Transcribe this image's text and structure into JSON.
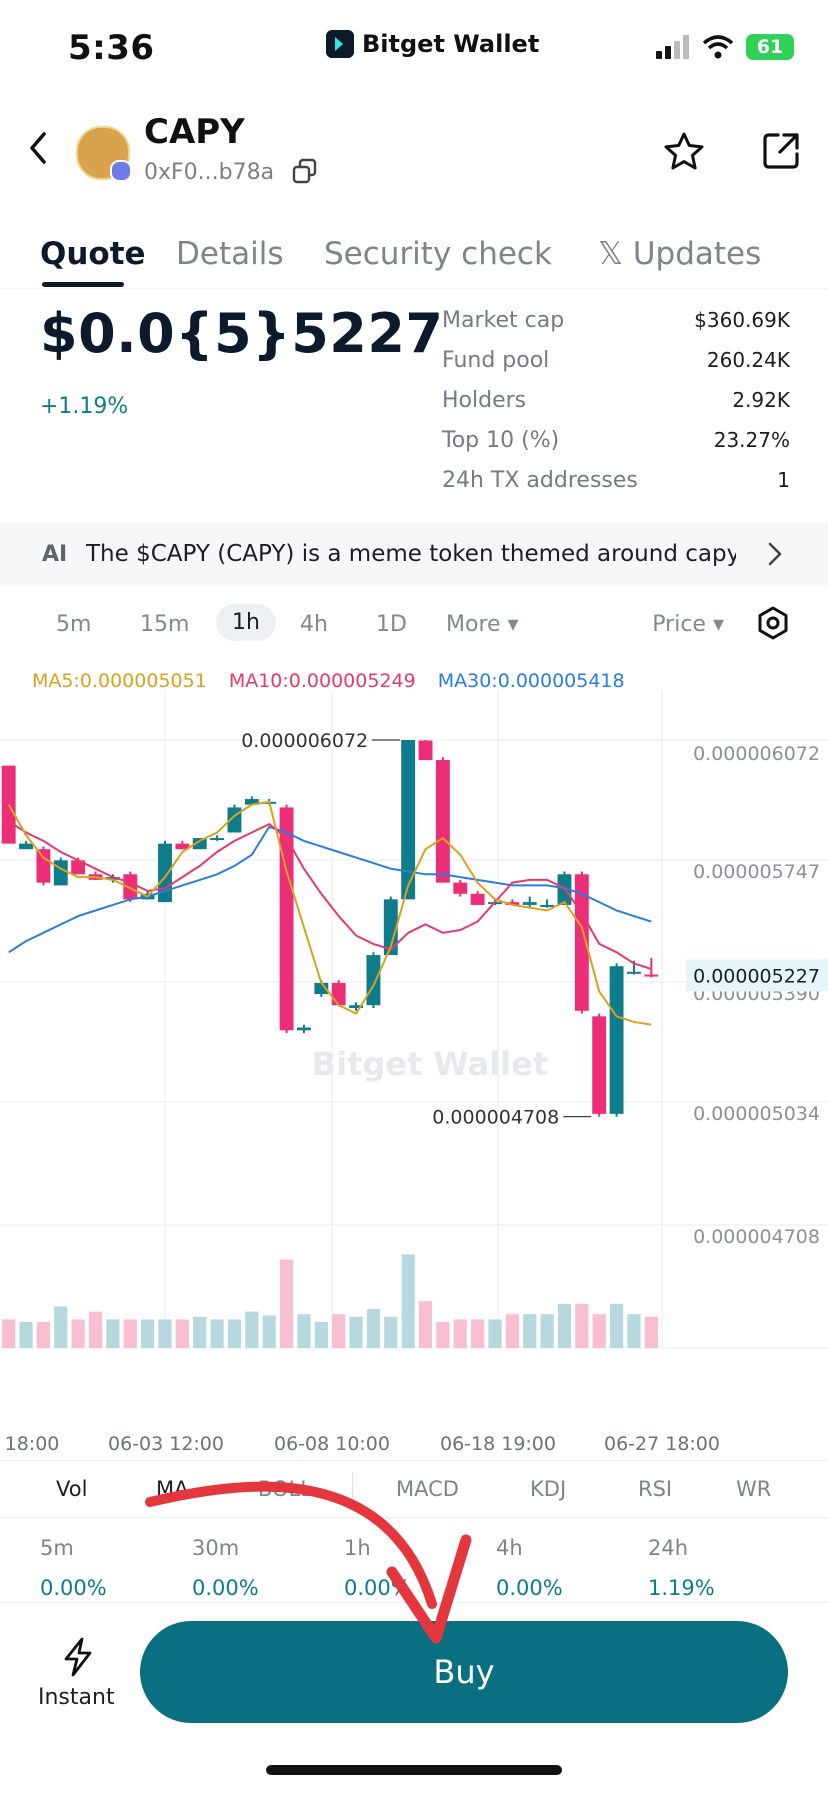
{
  "status_bar": {
    "time": "5:36",
    "brand": "Bitget Wallet",
    "battery": "61"
  },
  "token": {
    "name": "CAPY",
    "address": "0xF0...b78a"
  },
  "tabs": [
    {
      "label": "Quote"
    },
    {
      "label": "Details"
    },
    {
      "label": "Security check"
    },
    {
      "label": "𝕏 Updates"
    }
  ],
  "price": {
    "value": "$0.0{5}5227",
    "change": "+1.19%"
  },
  "stats": [
    {
      "label": "Market cap",
      "value": "$360.69K"
    },
    {
      "label": "Fund pool",
      "value": "260.24K"
    },
    {
      "label": "Holders",
      "value": "2.92K"
    },
    {
      "label": "Top 10 (%)",
      "value": "23.27%"
    },
    {
      "label": "24h TX addresses",
      "value": "1"
    }
  ],
  "ai_banner": {
    "icon": "AI",
    "text": "The $CAPY (CAPY) is a meme token themed around capy..."
  },
  "intervals": {
    "items": [
      "5m",
      "15m",
      "1h",
      "4h",
      "1D"
    ],
    "active": "1h",
    "more": "More ▾",
    "price_selector": "Price ▾"
  },
  "ma_legend": {
    "ma5": "MA5:0.000005051",
    "ma10": "MA10:0.000005249",
    "ma30": "MA30:0.000005418"
  },
  "colors": {
    "up": "#0f7c8c",
    "down": "#ec2d77",
    "ma5": "#d9a21e",
    "ma10": "#e8396f",
    "ma30": "#2a7de1",
    "buy": "#0a6f80"
  },
  "chart_data": {
    "type": "candlestick",
    "watermark": "Bitget Wallet",
    "y_ticks": [
      "0.000006072",
      "0.000005747",
      "0.000005390",
      "0.000005034",
      "0.000004708"
    ],
    "current_price_label": "0.000005227",
    "high_label": "0.000006072",
    "low_label": "0.000004708",
    "x_ticks": [
      "18:00",
      "06-03 12:00",
      "06-08 10:00",
      "06-18 19:00",
      "06-27 18:00"
    ],
    "ylim": [
      4.708e-06,
      6.072e-06
    ],
    "candles": [
      [
        5.98e-06,
        5.7e-06,
        5.98e-06,
        5.7e-06
      ],
      [
        5.68e-06,
        5.7e-06,
        5.71e-06,
        5.68e-06
      ],
      [
        5.68e-06,
        5.56e-06,
        5.69e-06,
        5.55e-06
      ],
      [
        5.55e-06,
        5.64e-06,
        5.65e-06,
        5.55e-06
      ],
      [
        5.64e-06,
        5.59e-06,
        5.65e-06,
        5.59e-06
      ],
      [
        5.59e-06,
        5.57e-06,
        5.6e-06,
        5.57e-06
      ],
      [
        5.57e-06,
        5.58e-06,
        5.59e-06,
        5.56e-06
      ],
      [
        5.59e-06,
        5.5e-06,
        5.6e-06,
        5.49e-06
      ],
      [
        5.5e-06,
        5.52e-06,
        5.53e-06,
        5.5e-06
      ],
      [
        5.49e-06,
        5.7e-06,
        5.71e-06,
        5.49e-06
      ],
      [
        5.7e-06,
        5.68e-06,
        5.71e-06,
        5.68e-06
      ],
      [
        5.68e-06,
        5.72e-06,
        5.72e-06,
        5.68e-06
      ],
      [
        5.72e-06,
        5.72e-06,
        5.73e-06,
        5.71e-06
      ],
      [
        5.74e-06,
        5.83e-06,
        5.84e-06,
        5.74e-06
      ],
      [
        5.84e-06,
        5.86e-06,
        5.87e-06,
        5.84e-06
      ],
      [
        5.85e-06,
        5.85e-06,
        5.86e-06,
        5.84e-06
      ],
      [
        5.83e-06,
        5.03e-06,
        5.84e-06,
        5.02e-06
      ],
      [
        5.03e-06,
        5.04e-06,
        5.05e-06,
        5.02e-06
      ],
      [
        5.16e-06,
        5.2e-06,
        5.21e-06,
        5.15e-06
      ],
      [
        5.2e-06,
        5.12e-06,
        5.21e-06,
        5.12e-06
      ],
      [
        5.11e-06,
        5.12e-06,
        5.13e-06,
        5.1e-06
      ],
      [
        5.12e-06,
        5.3e-06,
        5.31e-06,
        5.11e-06
      ],
      [
        5.3e-06,
        5.5e-06,
        5.51e-06,
        5.3e-06
      ],
      [
        5.5e-06,
        6.072e-06,
        6.072e-06,
        5.5e-06
      ],
      [
        6.07e-06,
        6e-06,
        6.072e-06,
        6e-06
      ],
      [
        6e-06,
        5.56e-06,
        6.01e-06,
        5.56e-06
      ],
      [
        5.56e-06,
        5.52e-06,
        5.57e-06,
        5.51e-06
      ],
      [
        5.52e-06,
        5.48e-06,
        5.53e-06,
        5.48e-06
      ],
      [
        5.49e-06,
        5.49e-06,
        5.5e-06,
        5.48e-06
      ],
      [
        5.49e-06,
        5.48e-06,
        5.5e-06,
        5.48e-06
      ],
      [
        5.48e-06,
        5.49e-06,
        5.51e-06,
        5.47e-06
      ],
      [
        5.48e-06,
        5.48e-06,
        5.5e-06,
        5.47e-06
      ],
      [
        5.48e-06,
        5.59e-06,
        5.6e-06,
        5.48e-06
      ],
      [
        5.59e-06,
        5.1e-06,
        5.6e-06,
        5.09e-06
      ],
      [
        5.08e-06,
        4.73e-06,
        5.09e-06,
        4.72e-06
      ],
      [
        4.73e-06,
        5.26e-06,
        5.27e-06,
        4.72e-06
      ],
      [
        5.24e-06,
        5.24e-06,
        5.28e-06,
        5.23e-06
      ],
      [
        5.23e-06,
        5.227e-06,
        5.29e-06,
        5.22e-06
      ]
    ],
    "ma5": [
      5.84e-06,
      5.73e-06,
      5.65e-06,
      5.61e-06,
      5.58e-06,
      5.58e-06,
      5.57e-06,
      5.54e-06,
      5.51e-06,
      5.58e-06,
      5.67e-06,
      5.71e-06,
      5.74e-06,
      5.8e-06,
      5.84e-06,
      5.85e-06,
      5.6e-06,
      5.4e-06,
      5.2e-06,
      5.12e-06,
      5.09e-06,
      5.19e-06,
      5.33e-06,
      5.55e-06,
      5.68e-06,
      5.72e-06,
      5.66e-06,
      5.56e-06,
      5.5e-06,
      5.48e-06,
      5.47e-06,
      5.46e-06,
      5.49e-06,
      5.4e-06,
      5.17e-06,
      5.08e-06,
      5.06e-06,
      5.05e-06
    ],
    "ma10": [
      5.78e-06,
      5.74e-06,
      5.71e-06,
      5.67e-06,
      5.64e-06,
      5.61e-06,
      5.58e-06,
      5.56e-06,
      5.53e-06,
      5.54e-06,
      5.58e-06,
      5.62e-06,
      5.67e-06,
      5.71e-06,
      5.74e-06,
      5.77e-06,
      5.72e-06,
      5.61e-06,
      5.52e-06,
      5.44e-06,
      5.37e-06,
      5.34e-06,
      5.32e-06,
      5.38e-06,
      5.41e-06,
      5.38e-06,
      5.39e-06,
      5.42e-06,
      5.49e-06,
      5.56e-06,
      5.57e-06,
      5.57e-06,
      5.54e-06,
      5.45e-06,
      5.34e-06,
      5.31e-06,
      5.27e-06,
      5.25e-06
    ],
    "ma30": [
      5.31e-06,
      5.35e-06,
      5.38e-06,
      5.41e-06,
      5.44e-06,
      5.46e-06,
      5.48e-06,
      5.5e-06,
      5.51e-06,
      5.53e-06,
      5.55e-06,
      5.57e-06,
      5.59e-06,
      5.62e-06,
      5.66e-06,
      5.76e-06,
      5.74e-06,
      5.71e-06,
      5.69e-06,
      5.67e-06,
      5.65e-06,
      5.63e-06,
      5.61e-06,
      5.6e-06,
      5.59e-06,
      5.59e-06,
      5.58e-06,
      5.57e-06,
      5.56e-06,
      5.55e-06,
      5.55e-06,
      5.55e-06,
      5.54e-06,
      5.52e-06,
      5.49e-06,
      5.46e-06,
      5.44e-06,
      5.42e-06
    ],
    "volume": [
      0.22,
      0.2,
      0.2,
      0.32,
      0.22,
      0.28,
      0.22,
      0.22,
      0.22,
      0.22,
      0.22,
      0.24,
      0.22,
      0.22,
      0.28,
      0.25,
      0.68,
      0.26,
      0.2,
      0.26,
      0.24,
      0.3,
      0.24,
      0.72,
      0.36,
      0.2,
      0.22,
      0.22,
      0.22,
      0.26,
      0.26,
      0.26,
      0.34,
      0.34,
      0.26,
      0.34,
      0.26,
      0.24
    ]
  },
  "indicators": [
    "Vol",
    "MA",
    "BOLL",
    "MACD",
    "KDJ",
    "RSI",
    "WR"
  ],
  "changes": [
    {
      "label": "5m",
      "value": "0.00%"
    },
    {
      "label": "30m",
      "value": "0.00%"
    },
    {
      "label": "1h",
      "value": "0.00%"
    },
    {
      "label": "4h",
      "value": "0.00%"
    },
    {
      "label": "24h",
      "value": "1.19%"
    }
  ],
  "bottom": {
    "instant_label": "Instant",
    "buy_label": "Buy"
  }
}
